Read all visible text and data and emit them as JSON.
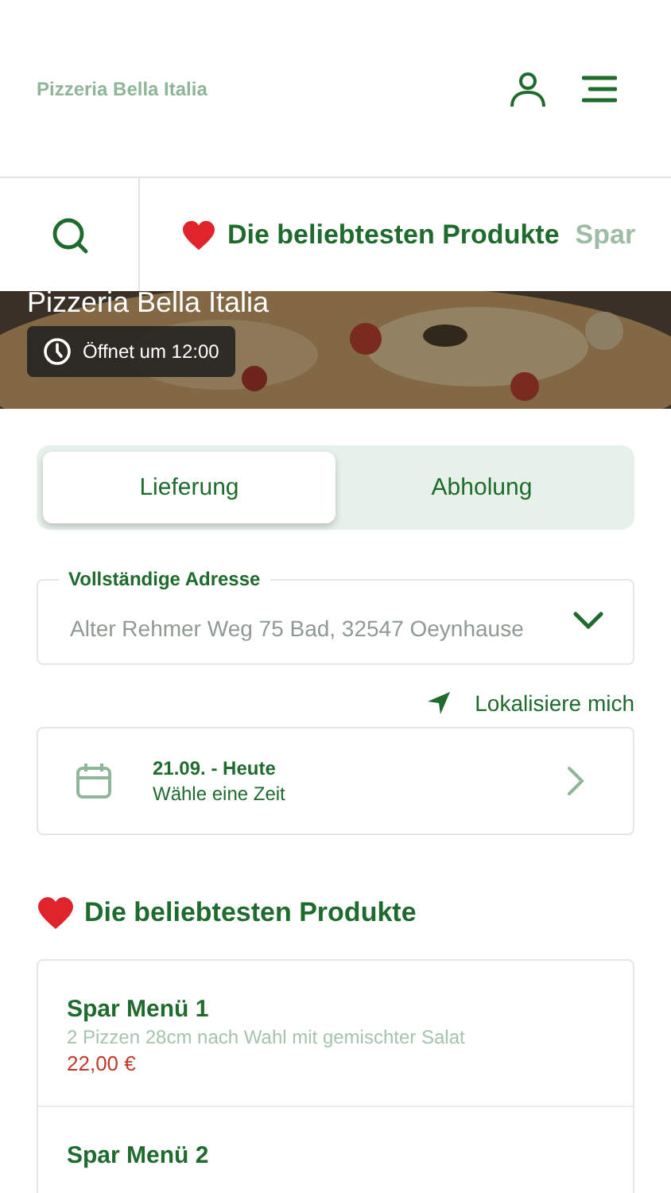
{
  "header": {
    "brand": "Pizzeria Bella Italia"
  },
  "category_tabs": [
    {
      "label": "Die beliebtesten Produkte",
      "selected": true
    },
    {
      "label": "Spar",
      "selected": false
    }
  ],
  "hero": {
    "title": "Pizzeria Bella Italia",
    "opening": "Öffnet um 12:00"
  },
  "mode_tabs": [
    {
      "label": "Lieferung",
      "selected": true
    },
    {
      "label": "Abholung",
      "selected": false
    }
  ],
  "address": {
    "label": "Vollständige Adresse",
    "placeholder": "Alter Rehmer Weg 75 Bad, 32547 Oeynhause"
  },
  "locate": "Lokalisiere mich",
  "schedule": {
    "date": "21.09. - Heute",
    "hint": "Wähle eine Zeit"
  },
  "section_title": "Die beliebtesten Produkte",
  "products": [
    {
      "name": "Spar Menü 1",
      "description": "2 Pizzen 28cm nach Wahl mit gemischter Salat",
      "price": "22,00 €"
    },
    {
      "name": "Spar Menü 2"
    }
  ]
}
